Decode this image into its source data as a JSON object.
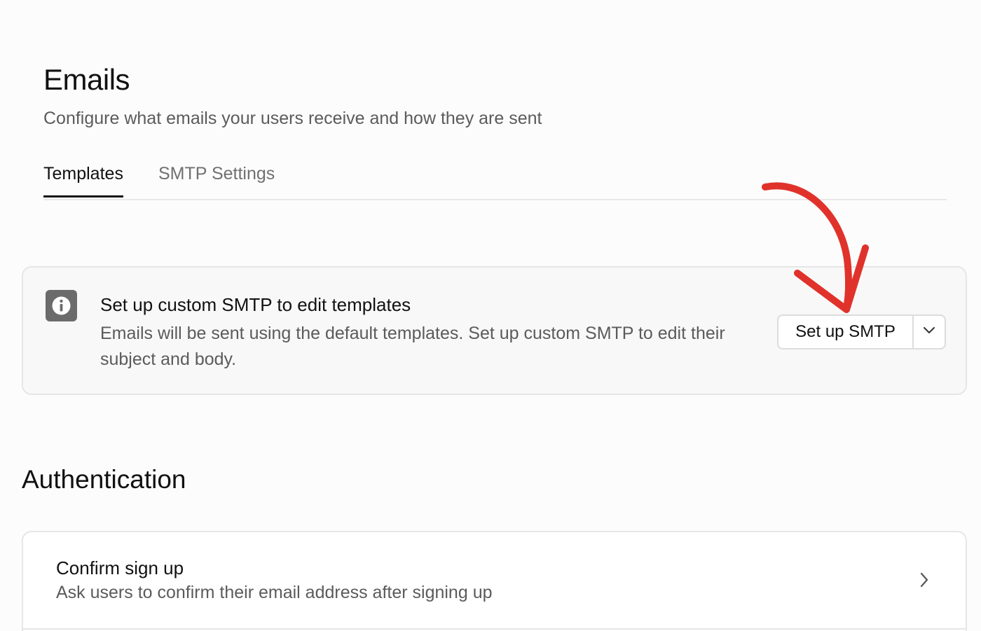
{
  "header": {
    "title": "Emails",
    "subtitle": "Configure what emails your users receive and how they are sent"
  },
  "tabs": [
    {
      "label": "Templates",
      "active": true
    },
    {
      "label": "SMTP Settings",
      "active": false
    }
  ],
  "notice": {
    "icon": "info-icon",
    "title": "Set up custom SMTP to edit templates",
    "body": "Emails will be sent using the default templates. Set up custom SMTP to edit their subject and body.",
    "button_label": "Set up SMTP",
    "dropdown_icon": "chevron-down-icon"
  },
  "annotation": {
    "arrow_color": "#e0322b"
  },
  "authentication": {
    "title": "Authentication",
    "items": [
      {
        "title": "Confirm sign up",
        "description": "Ask users to confirm their email address after signing up",
        "icon": "chevron-right-icon"
      }
    ]
  }
}
